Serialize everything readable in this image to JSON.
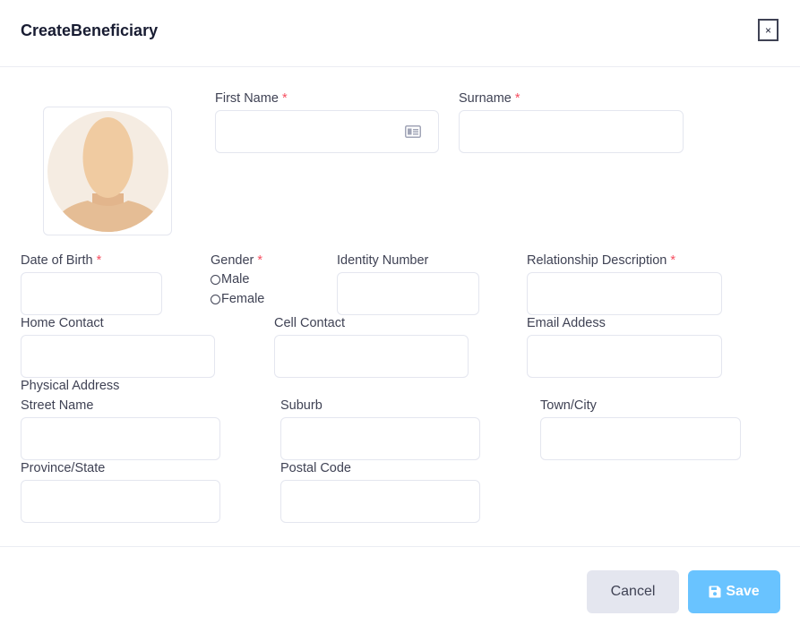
{
  "modal": {
    "title": "CreateBeneficiary",
    "close_label": "×"
  },
  "fields": {
    "first_name": {
      "label": "First Name",
      "required": "*",
      "value": ""
    },
    "surname": {
      "label": "Surname",
      "required": "*",
      "value": ""
    },
    "date_of_birth": {
      "label": "Date of Birth",
      "required": "*",
      "value": ""
    },
    "gender": {
      "label": "Gender",
      "required": "*",
      "options": [
        "Male",
        "Female"
      ]
    },
    "identity_number": {
      "label": "Identity Number",
      "value": ""
    },
    "relationship_description": {
      "label": "Relationship Description",
      "required": "*",
      "value": ""
    },
    "home_contact": {
      "label": "Home Contact",
      "value": ""
    },
    "cell_contact": {
      "label": "Cell Contact",
      "value": ""
    },
    "email_address": {
      "label": "Email Addess",
      "value": ""
    },
    "physical_address": {
      "label": "Physical Address"
    },
    "street_name": {
      "label": "Street Name",
      "value": ""
    },
    "suburb": {
      "label": "Suburb",
      "value": ""
    },
    "town_city": {
      "label": "Town/City",
      "value": ""
    },
    "province_state": {
      "label": "Province/State",
      "value": ""
    },
    "postal_code": {
      "label": "Postal Code",
      "value": ""
    }
  },
  "footer": {
    "cancel_label": "Cancel",
    "save_label": "Save"
  },
  "icons": {
    "avatar": "person-silhouette-icon",
    "first_name_suffix": "id-card-icon",
    "save": "floppy-disk-icon",
    "close": "close-icon"
  },
  "colors": {
    "required": "#f64e60",
    "save_button": "#69c3ff",
    "cancel_button": "#e4e6ef"
  }
}
